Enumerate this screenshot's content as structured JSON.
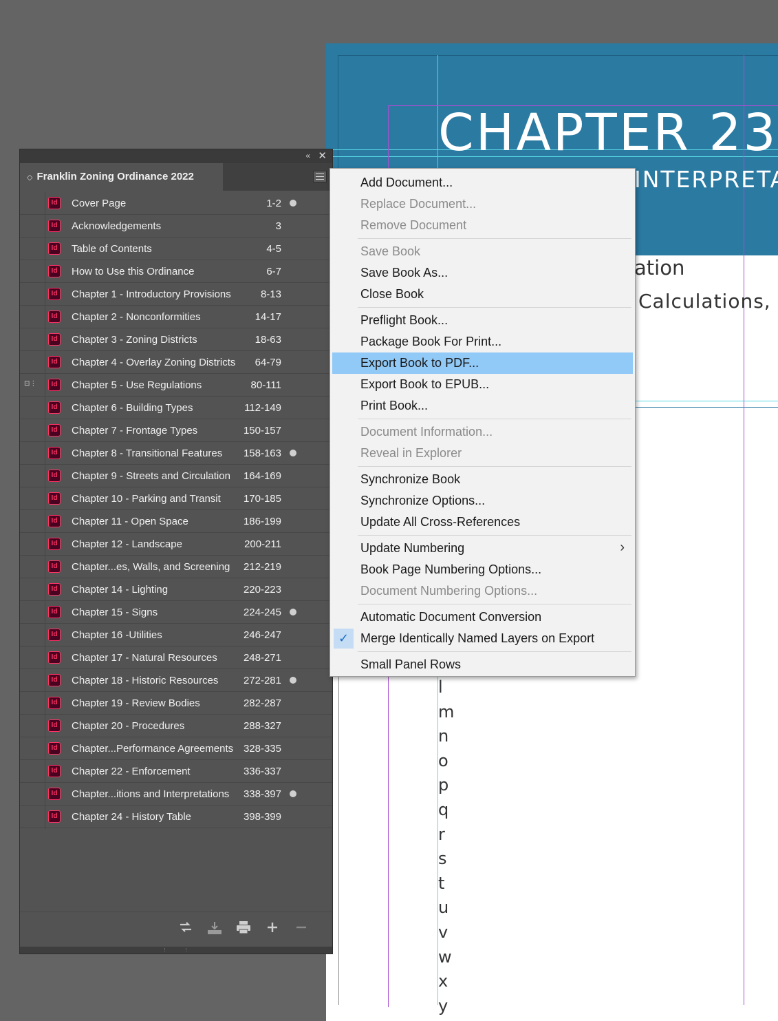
{
  "document": {
    "title": "CHAPTER 23",
    "subtitle": "INTERPRETATI",
    "line1": "ation",
    "line2": "Calculations,  ar",
    "letters": [
      "l",
      "m",
      "n",
      "o",
      "p",
      "q",
      "r",
      "s",
      "t",
      "u",
      "v",
      "w",
      "x",
      "y"
    ]
  },
  "panel": {
    "collapse_icon": "«",
    "close_icon": "✕",
    "title": "Franklin Zoning Ordinance 2022",
    "documents": [
      {
        "name": "Cover Page",
        "pages": "1-2",
        "modified": true
      },
      {
        "name": "Acknowledgements",
        "pages": "3",
        "modified": false
      },
      {
        "name": "Table of Contents",
        "pages": "4-5",
        "modified": false
      },
      {
        "name": "How to Use this Ordinance",
        "pages": "6-7",
        "modified": false
      },
      {
        "name": "Chapter 1 - Introductory Provisions",
        "pages": "8-13",
        "modified": false
      },
      {
        "name": "Chapter 2 - Nonconformities",
        "pages": "14-17",
        "modified": false
      },
      {
        "name": "Chapter 3 - Zoning Districts",
        "pages": "18-63",
        "modified": false
      },
      {
        "name": "Chapter 4 - Overlay Zoning Districts",
        "pages": "64-79",
        "modified": false
      },
      {
        "name": "Chapter 5 - Use Regulations",
        "pages": "80-111",
        "modified": false,
        "style_source": true
      },
      {
        "name": "Chapter 6 - Building Types",
        "pages": "112-149",
        "modified": false
      },
      {
        "name": "Chapter 7 - Frontage Types",
        "pages": "150-157",
        "modified": false
      },
      {
        "name": "Chapter 8 - Transitional Features",
        "pages": "158-163",
        "modified": true
      },
      {
        "name": "Chapter 9 - Streets and Circulation",
        "pages": "164-169",
        "modified": false
      },
      {
        "name": "Chapter 10 - Parking and Transit",
        "pages": "170-185",
        "modified": false
      },
      {
        "name": "Chapter 11 - Open Space",
        "pages": "186-199",
        "modified": false
      },
      {
        "name": "Chapter 12 - Landscape",
        "pages": "200-211",
        "modified": false
      },
      {
        "name": "Chapter...es, Walls, and Screening",
        "pages": "212-219",
        "modified": false
      },
      {
        "name": "Chapter 14 - Lighting",
        "pages": "220-223",
        "modified": false
      },
      {
        "name": "Chapter 15 - Signs",
        "pages": "224-245",
        "modified": true
      },
      {
        "name": "Chapter 16 -Utilities",
        "pages": "246-247",
        "modified": false
      },
      {
        "name": "Chapter 17 - Natural Resources",
        "pages": "248-271",
        "modified": false
      },
      {
        "name": "Chapter 18 - Historic Resources",
        "pages": "272-281",
        "modified": true
      },
      {
        "name": "Chapter 19 - Review Bodies",
        "pages": "282-287",
        "modified": false
      },
      {
        "name": "Chapter 20 - Procedures",
        "pages": "288-327",
        "modified": false
      },
      {
        "name": "Chapter...Performance Agreements",
        "pages": "328-335",
        "modified": false
      },
      {
        "name": "Chapter 22 - Enforcement",
        "pages": "336-337",
        "modified": false
      },
      {
        "name": "Chapter...itions and Interpretations",
        "pages": "338-397",
        "modified": true
      },
      {
        "name": "Chapter 24 - History Table",
        "pages": "398-399",
        "modified": false
      }
    ],
    "document_icon_label": "Id",
    "bottom_icons": [
      "sync-styles-icon",
      "save-book-icon",
      "print-book-icon",
      "add-document-icon",
      "remove-document-icon"
    ]
  },
  "menu": {
    "items": [
      {
        "label": "Add Document...",
        "disabled": false
      },
      {
        "label": "Replace Document...",
        "disabled": true
      },
      {
        "label": "Remove Document",
        "disabled": true
      },
      {
        "sep": true
      },
      {
        "label": "Save Book",
        "disabled": true
      },
      {
        "label": "Save Book As...",
        "disabled": false
      },
      {
        "label": "Close Book",
        "disabled": false
      },
      {
        "sep": true
      },
      {
        "label": "Preflight Book...",
        "disabled": false
      },
      {
        "label": "Package Book For Print...",
        "disabled": false
      },
      {
        "label": "Export Book to PDF...",
        "disabled": false,
        "highlighted": true
      },
      {
        "label": "Export Book to EPUB...",
        "disabled": false
      },
      {
        "label": "Print Book...",
        "disabled": false
      },
      {
        "sep": true
      },
      {
        "label": "Document Information...",
        "disabled": true
      },
      {
        "label": "Reveal in Explorer",
        "disabled": true
      },
      {
        "sep": true
      },
      {
        "label": "Synchronize Book",
        "disabled": false
      },
      {
        "label": "Synchronize Options...",
        "disabled": false
      },
      {
        "label": "Update All Cross-References",
        "disabled": false
      },
      {
        "sep": true
      },
      {
        "label": "Update Numbering",
        "disabled": false,
        "submenu": true
      },
      {
        "label": "Book Page Numbering Options...",
        "disabled": false
      },
      {
        "label": "Document Numbering Options...",
        "disabled": true
      },
      {
        "sep": true
      },
      {
        "label": "Automatic Document Conversion",
        "disabled": false
      },
      {
        "label": "Merge Identically Named Layers on Export",
        "disabled": false,
        "checked": true
      },
      {
        "sep": true
      },
      {
        "label": "Small Panel Rows",
        "disabled": false
      }
    ],
    "submenu_arrow": "›",
    "check_mark": "✓"
  },
  "colors": {
    "panel_bg": "#535353",
    "band": "#2a7aa2",
    "highlight": "#91c9f7",
    "indesign_icon": "#ff3366",
    "guide_cyan": "#58d8e6",
    "guide_purple": "#a84fd0"
  }
}
